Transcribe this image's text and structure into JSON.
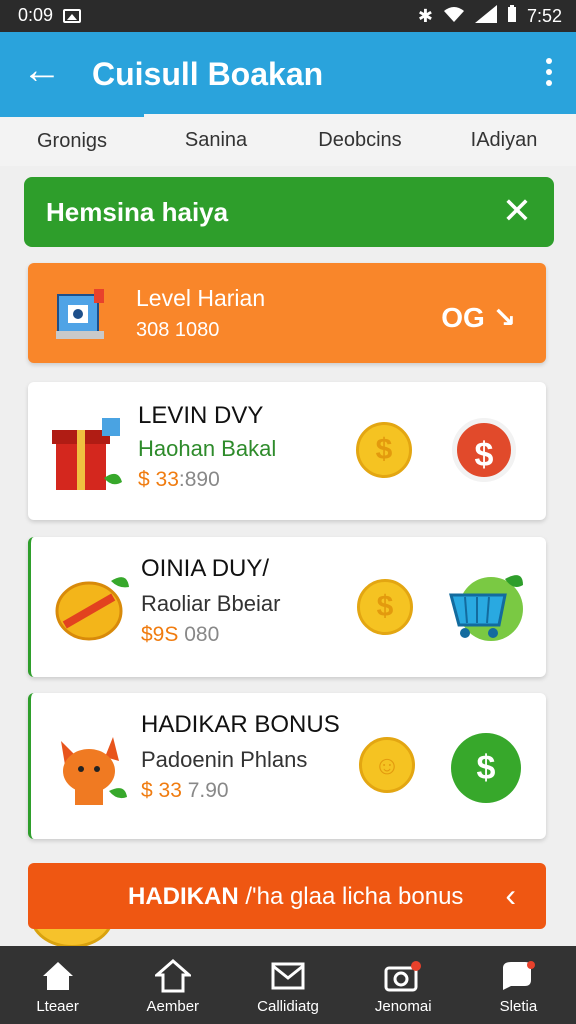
{
  "status_bar": {
    "time_left": "0:09",
    "time_right": "7:52"
  },
  "app_bar": {
    "title": "Cuisull Boakan",
    "back_icon": "arrow-left-icon",
    "menu_icon": "more-vert-icon"
  },
  "tabs": [
    {
      "label": "Gronigs"
    },
    {
      "label": "Sanina"
    },
    {
      "label": "Deobcins"
    },
    {
      "label": "IAdiyan"
    }
  ],
  "banner": {
    "text": "Hemsina haiya",
    "close_icon": "close-icon"
  },
  "level_card": {
    "title": "Level Harian",
    "value": "308 1080",
    "percent": "OG ↘"
  },
  "cards": [
    {
      "heading": "LEVIN DVY",
      "subtitle": "Haohan Bakal",
      "price_prefix": "$ 33",
      "price_rest": ":890"
    },
    {
      "heading": "OINIA DUY/",
      "subtitle": "Raoliar Bbeiar",
      "price_prefix": "$9S",
      "price_rest": "080"
    },
    {
      "heading": "HADIKAR BONUS",
      "subtitle": "Padoenin Phlans",
      "price_prefix": "$ 33",
      "price_rest": "7.90"
    }
  ],
  "bottom_promo": {
    "bold_text": "HADIKAN",
    "rest_text": " /'ha glaa licha bonus",
    "arrow": "‹"
  },
  "bottom_nav": [
    {
      "label": "Lteaer",
      "icon": "home-icon"
    },
    {
      "label": "Aember",
      "icon": "house-icon"
    },
    {
      "label": "Callidiatg",
      "icon": "mail-icon"
    },
    {
      "label": "Jenomai",
      "icon": "camera-icon"
    },
    {
      "label": "Sletia",
      "icon": "heart-chat-icon"
    }
  ],
  "colors": {
    "app_bar": "#2aa3dc",
    "banner": "#2e9e2b",
    "level_card": "#f9862a",
    "promo": "#ef5712",
    "nav": "#333333"
  }
}
